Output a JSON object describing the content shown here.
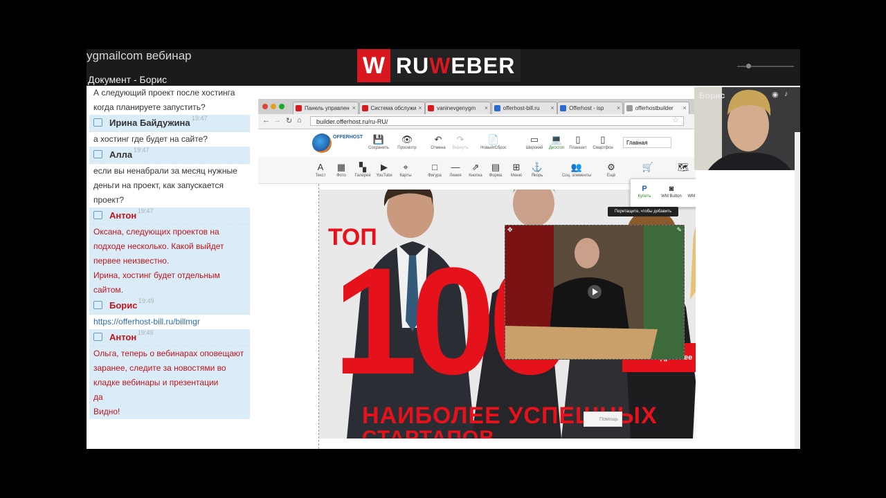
{
  "window": {
    "title": "ygmailcom вебинар",
    "document_title": "Документ - Борис",
    "logo_w": "W",
    "logo_text_before": "RU",
    "logo_text_accent": "W",
    "logo_text_after": "EBER"
  },
  "chat": {
    "messages": [
      {
        "type": "text",
        "color": "dark",
        "lines": [
          "А следующий проект после хостинга",
          "когда планируете запустить?"
        ]
      },
      {
        "type": "head",
        "name": "Ирина Байдужина",
        "time": "19:47",
        "color": "dark"
      },
      {
        "type": "text",
        "color": "dark",
        "lines": [
          "а хостинг где будет на сайте?"
        ]
      },
      {
        "type": "head",
        "name": "Алла",
        "time": "19:47",
        "color": "dark"
      },
      {
        "type": "text",
        "color": "dark",
        "lines": [
          "если вы ненабрали за месяц нужные",
          "деньги на проект, как запускается",
          "проект?"
        ]
      },
      {
        "type": "head",
        "name": "Антон",
        "time": "19:47",
        "color": "red"
      },
      {
        "type": "text",
        "color": "red",
        "lines": [
          "Оксана, следующих проектов на",
          "подходе несколько. Какой выйдет",
          "первее неизвестно.",
          "Ирина, хостинг будет отдельным",
          "сайтом."
        ]
      },
      {
        "type": "head",
        "name": "Борис",
        "time": "19:49",
        "color": "red"
      },
      {
        "type": "text",
        "color": "link",
        "lines": [
          "https://offerhost-bill.ru/billmgr"
        ]
      },
      {
        "type": "head",
        "name": "Антон",
        "time": "19:49",
        "color": "red"
      },
      {
        "type": "text",
        "color": "red",
        "lines": [
          "Ольга, теперь о вебинарах оповещают",
          "заранее, следите за новостями во",
          "кладке вебинары и презентации",
          "да",
          "Видно!"
        ]
      }
    ]
  },
  "browser": {
    "tabs": [
      {
        "label": "Панель управлен",
        "color": "#d7191f"
      },
      {
        "label": "Система обслужи",
        "color": "#d7191f"
      },
      {
        "label": "vaninevgenygm",
        "color": "#d7191f"
      },
      {
        "label": "offerhost-bill.ru",
        "color": "#2a6ad4"
      },
      {
        "label": "Offerhost - isp",
        "color": "#2a6ad4"
      },
      {
        "label": "offerhostbuilder",
        "color": "#999999"
      }
    ],
    "url": "builder.offerhost.ru/ru-RU/",
    "toolbar1": [
      {
        "icon": "💾",
        "label": "Сохранить",
        "name": "save"
      },
      {
        "icon": "👁",
        "label": "Просмотр",
        "name": "preview"
      },
      {
        "icon": "↶",
        "label": "Отмена",
        "name": "undo"
      },
      {
        "icon": "↷",
        "label": "Вернуть",
        "name": "redo"
      },
      {
        "icon": "📄",
        "label": "Новый/Сброс",
        "name": "new-reset"
      },
      {
        "icon": "▭",
        "label": "Широкий",
        "name": "wide"
      },
      {
        "icon": "💻",
        "label": "Десктоп",
        "name": "desktop"
      },
      {
        "icon": "▯",
        "label": "Планшет",
        "name": "tablet"
      },
      {
        "icon": "▯",
        "label": "Смартфон",
        "name": "smartphone"
      }
    ],
    "page_select": "Главная",
    "toolbar2": [
      {
        "icon": "A",
        "label": "Текст",
        "name": "text"
      },
      {
        "icon": "▦",
        "label": "Фото",
        "name": "photo"
      },
      {
        "icon": "▚",
        "label": "Галерея",
        "name": "gallery"
      },
      {
        "icon": "▶",
        "label": "YouTube",
        "name": "youtube"
      },
      {
        "icon": "⌖",
        "label": "Карты",
        "name": "maps"
      },
      {
        "icon": "□",
        "label": "Фигура",
        "name": "shape"
      },
      {
        "icon": "—",
        "label": "Линия",
        "name": "line"
      },
      {
        "icon": "⇗",
        "label": "Кнопка",
        "name": "button"
      },
      {
        "icon": "▤",
        "label": "Форма",
        "name": "form"
      },
      {
        "icon": "⊞",
        "label": "Меню",
        "name": "menu"
      },
      {
        "icon": "⚓",
        "label": "Якорь",
        "name": "anchor"
      },
      {
        "icon": "👥",
        "label": "Соц. элементы",
        "name": "social"
      },
      {
        "icon": "⚙",
        "label": "Ещё",
        "name": "more"
      },
      {
        "icon": "🛒",
        "label": "",
        "name": "cart"
      },
      {
        "icon": "🗺",
        "label": "",
        "name": "map-view"
      }
    ],
    "cart_popup": [
      {
        "icon": "P",
        "label": "Купить"
      },
      {
        "icon": "◙",
        "label": "WM Button"
      },
      {
        "icon": "◙",
        "label": "WM Widget"
      }
    ],
    "tooltip": "Перетащите, чтобы добавить",
    "hero": {
      "top_word": "ТОП",
      "big_number": "100",
      "headline_line1": "НАИБОЛЕЕ УСПЕШНЫХ",
      "headline_line2": "СТАРТАПОВ",
      "more_button": "Подробнее"
    },
    "help_button": "Помощь"
  },
  "webcam": {
    "name": "Борис"
  }
}
